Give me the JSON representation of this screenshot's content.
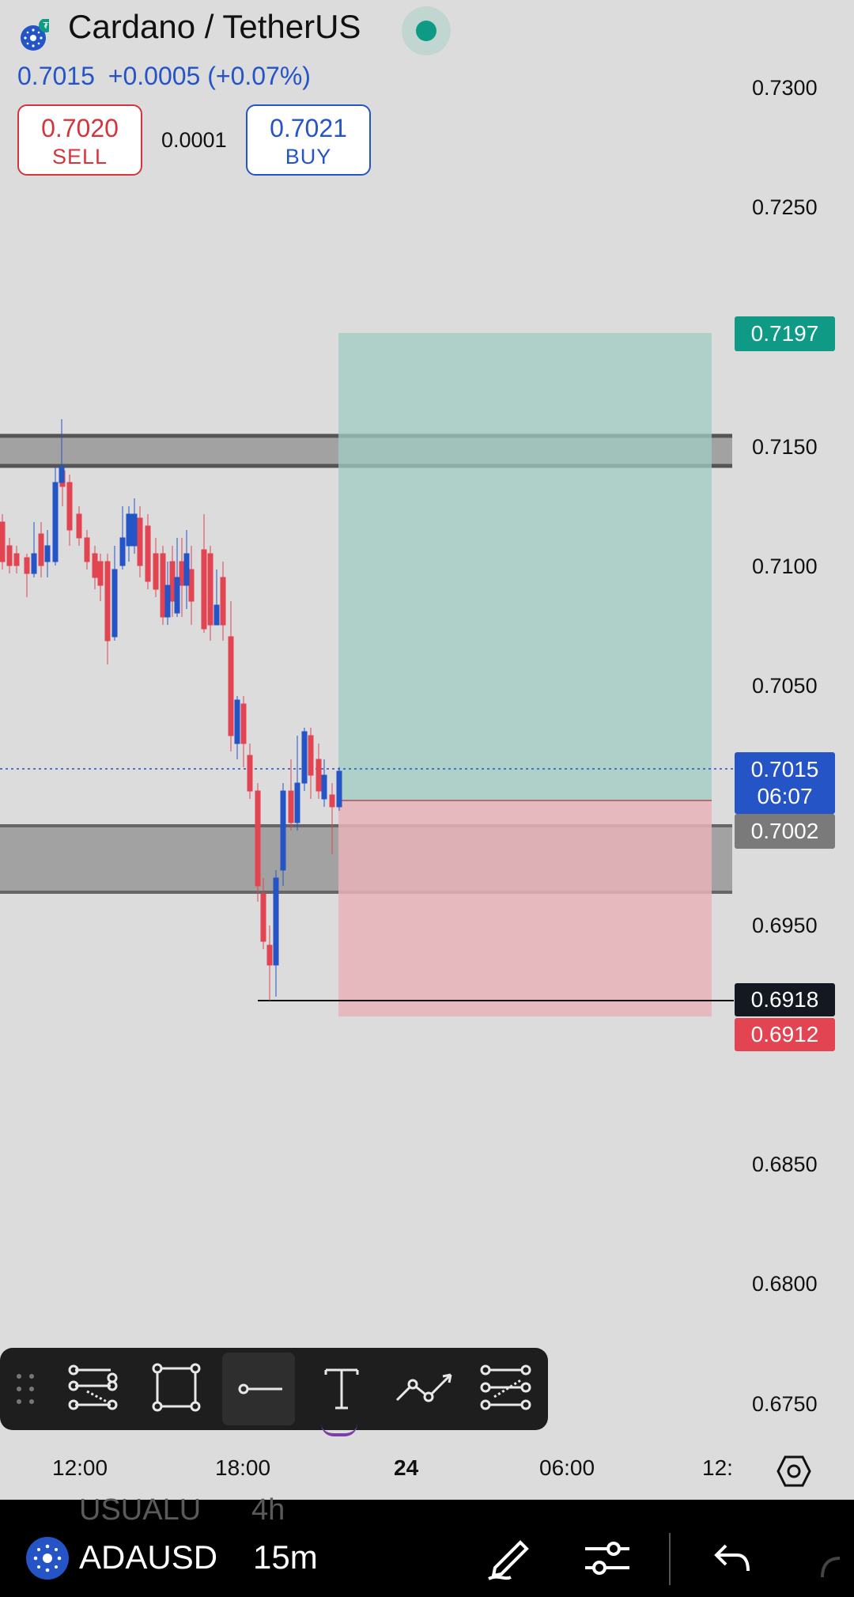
{
  "header": {
    "title": "Cardano / TetherUS",
    "last_price": "0.7015",
    "change": "+0.0005 (+0.07%)",
    "sell": {
      "price": "0.7020",
      "label": "SELL"
    },
    "spread": "0.0001",
    "buy": {
      "price": "0.7021",
      "label": "BUY"
    }
  },
  "y_axis": [
    "0.7300",
    "0.7250",
    "0.7150",
    "0.7100",
    "0.7050",
    "0.6950",
    "0.6850",
    "0.6800",
    "0.6750"
  ],
  "price_tags": {
    "target": "0.7197",
    "current_price": "0.7015",
    "countdown": "06:07",
    "entry": "0.7002",
    "crosshair": "0.6918",
    "stop": "0.6912"
  },
  "x_axis": [
    "12:00",
    "18:00",
    "24",
    "06:00",
    "12:"
  ],
  "toolbar": {
    "tools": [
      "trend-lines-icon",
      "rectangle-icon",
      "horizontal-line-icon",
      "text-icon",
      "path-icon",
      "fib-icon"
    ]
  },
  "bottom_bar": {
    "symbol": "ADAUSD",
    "interval": "15m",
    "ghost_symbol": "USUALU",
    "ghost_interval": "4h"
  },
  "colors": {
    "up": "#2554c7",
    "down": "#e24452",
    "target_zone": "#9fccc2",
    "stop_zone": "#e7b3ba",
    "zone_band": "#5a5a5a",
    "accent_green": "#0e9a84"
  }
}
